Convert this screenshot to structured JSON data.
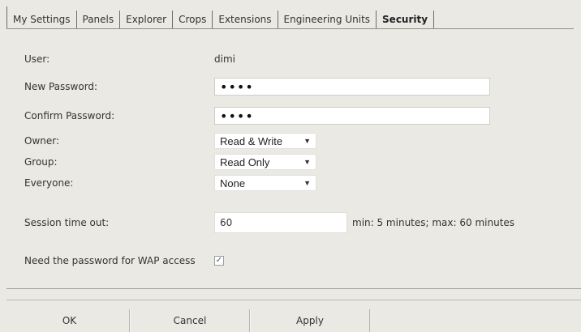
{
  "tabs": [
    {
      "label": "My Settings"
    },
    {
      "label": "Panels"
    },
    {
      "label": "Explorer"
    },
    {
      "label": "Crops"
    },
    {
      "label": "Extensions"
    },
    {
      "label": "Engineering Units"
    },
    {
      "label": "Security",
      "active": true
    }
  ],
  "form": {
    "user_label": "User:",
    "user_value": "dimi",
    "new_password_label": "New Password:",
    "new_password_value": "dimi",
    "confirm_password_label": "Confirm Password:",
    "confirm_password_value": "dimi",
    "owner_label": "Owner:",
    "owner_value": "Read & Write",
    "group_label": "Group:",
    "group_value": "Read Only",
    "everyone_label": "Everyone:",
    "everyone_value": "None",
    "session_label": "Session time out:",
    "session_value": "60",
    "session_hint": "min: 5 minutes; max: 60 minutes",
    "wap_label": "Need the password for WAP access",
    "wap_checked": true,
    "checkmark": "✓"
  },
  "icons": {
    "dropdown": "chevron-down-icon",
    "dropdown_glyph": "▼"
  },
  "buttons": {
    "ok": "OK",
    "cancel": "Cancel",
    "apply": "Apply"
  }
}
